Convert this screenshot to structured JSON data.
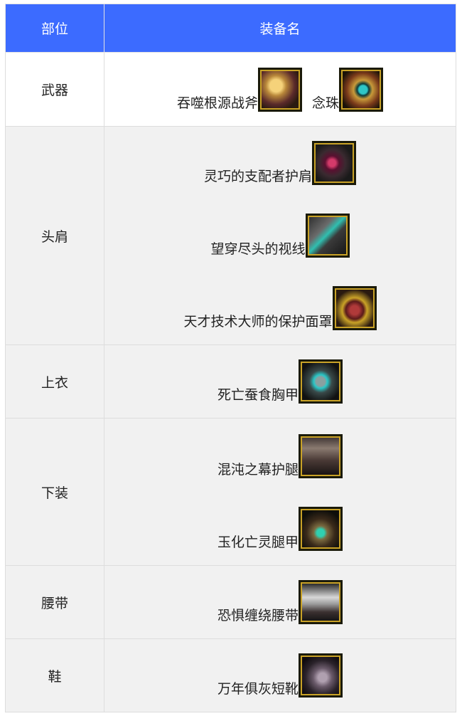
{
  "header": {
    "col_part": "部位",
    "col_name": "装备名"
  },
  "rows": {
    "weapon": {
      "part": "武器",
      "items": [
        {
          "name": "吞噬根源战斧",
          "icon": "axe-icon"
        },
        {
          "name": "念珠",
          "icon": "prayer-beads-icon"
        }
      ]
    },
    "head": {
      "part": "头肩",
      "items": [
        {
          "name": "灵巧的支配者护肩",
          "icon": "shoulder-guard-icon"
        },
        {
          "name": "望穿尽头的视线",
          "icon": "eye-gaze-icon"
        },
        {
          "name": "天才技术大师的保护面罩",
          "icon": "face-mask-icon"
        }
      ]
    },
    "chest": {
      "part": "上衣",
      "items": [
        {
          "name": "死亡蚕食胸甲",
          "icon": "chest-armor-icon"
        }
      ]
    },
    "legs": {
      "part": "下装",
      "items": [
        {
          "name": "混沌之幕护腿",
          "icon": "leg-guard-icon"
        },
        {
          "name": "玉化亡灵腿甲",
          "icon": "jade-leg-armor-icon"
        }
      ]
    },
    "belt": {
      "part": "腰带",
      "items": [
        {
          "name": "恐惧缠绕腰带",
          "icon": "belt-icon"
        }
      ]
    },
    "shoes": {
      "part": "鞋",
      "items": [
        {
          "name": "万年俱灰短靴",
          "icon": "boots-icon"
        }
      ]
    }
  },
  "colors": {
    "header_bg": "#3c6bff",
    "header_text": "#ffffff",
    "row_alt_bg": "#f1f1f1",
    "icon_frame": "#c9a227"
  }
}
